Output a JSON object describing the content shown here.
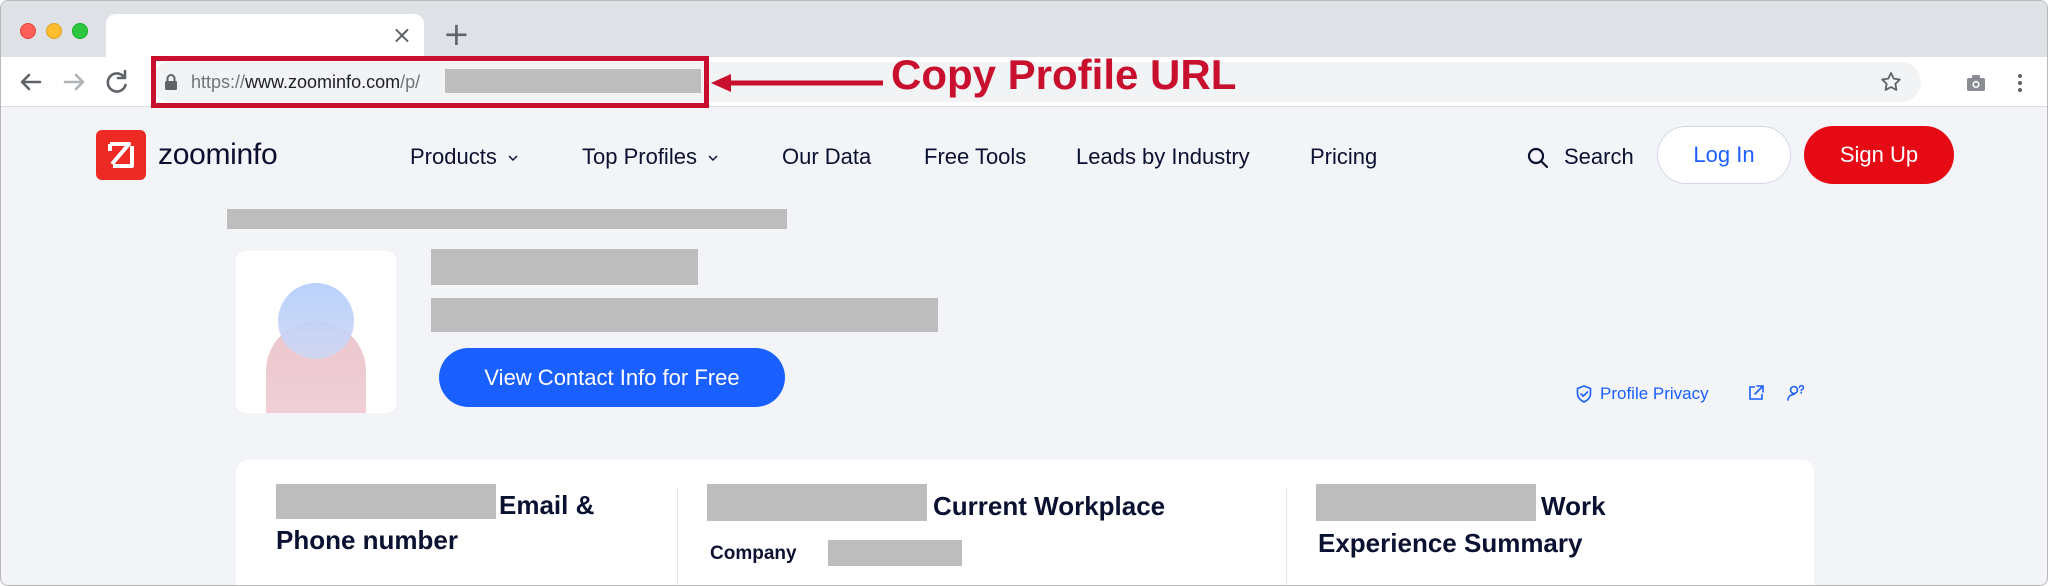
{
  "browser": {
    "tab_close": "×",
    "new_tab": "+",
    "url_prefix": "https://",
    "url_host": "www.zoominfo.com",
    "url_path": "/p/"
  },
  "annotation": {
    "label": "Copy Profile URL",
    "color": "#c8102e"
  },
  "site": {
    "logo_text": "zoominfo",
    "nav": [
      {
        "label": "Products",
        "dropdown": true
      },
      {
        "label": "Top Profiles",
        "dropdown": true
      },
      {
        "label": "Our Data",
        "dropdown": false
      },
      {
        "label": "Free Tools",
        "dropdown": false
      },
      {
        "label": "Leads by Industry",
        "dropdown": false
      },
      {
        "label": "Pricing",
        "dropdown": false
      }
    ],
    "search_label": "Search",
    "login_label": "Log In",
    "signup_label": "Sign Up",
    "brand_red": "#e60a14",
    "brand_blue": "#1a5fff"
  },
  "profile": {
    "view_contact_label": "View Contact Info for Free",
    "privacy_label": "Profile Privacy"
  },
  "cards": {
    "col1_title_a": "Email &",
    "col1_title_b": "Phone number",
    "col2_title": "Current Workplace",
    "company_label": "Company",
    "col3_title_a": "Work",
    "col3_title_b": "Experience Summary"
  }
}
